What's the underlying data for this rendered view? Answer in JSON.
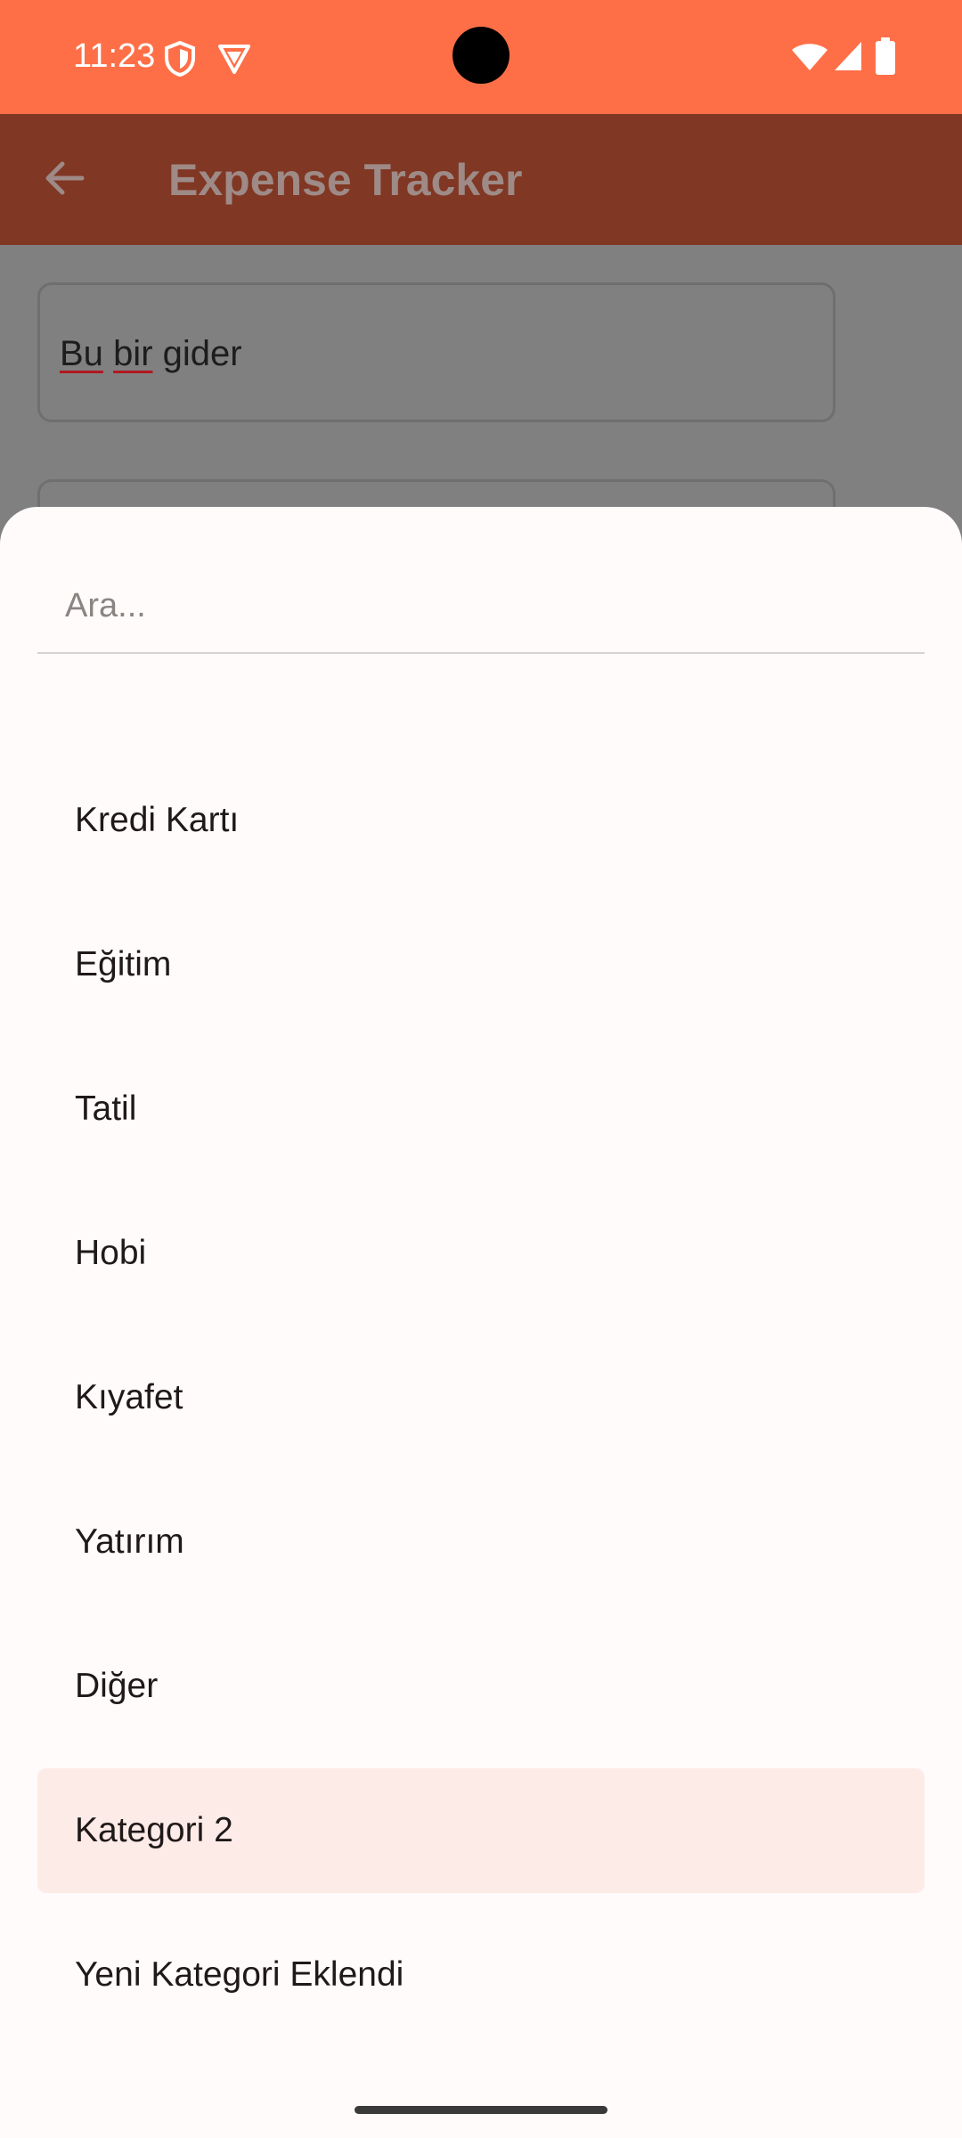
{
  "status_bar": {
    "time": "11:23",
    "left_icons": [
      "shield-icon",
      "vpn-badge-icon"
    ],
    "right_icons": [
      "wifi-icon",
      "cell-signal-icon",
      "battery-icon"
    ],
    "color": "#FF6F47"
  },
  "app_bar": {
    "title": "Expense Tracker",
    "back_icon": "arrow-back-icon"
  },
  "background_form": {
    "description_value": [
      "Bu",
      "bir",
      "gider"
    ]
  },
  "sheet": {
    "search_placeholder": "Ara...",
    "items": [
      {
        "label": "Kredi Kartı",
        "selected": false
      },
      {
        "label": "Eğitim",
        "selected": false
      },
      {
        "label": "Tatil",
        "selected": false
      },
      {
        "label": "Hobi",
        "selected": false
      },
      {
        "label": "Kıyafet",
        "selected": false
      },
      {
        "label": "Yatırım",
        "selected": false
      },
      {
        "label": "Diğer",
        "selected": false
      },
      {
        "label": "Kategori 2",
        "selected": true
      },
      {
        "label": "Yeni Kategori Eklendi",
        "selected": false
      }
    ],
    "selected_color": "#FDEBE8"
  }
}
